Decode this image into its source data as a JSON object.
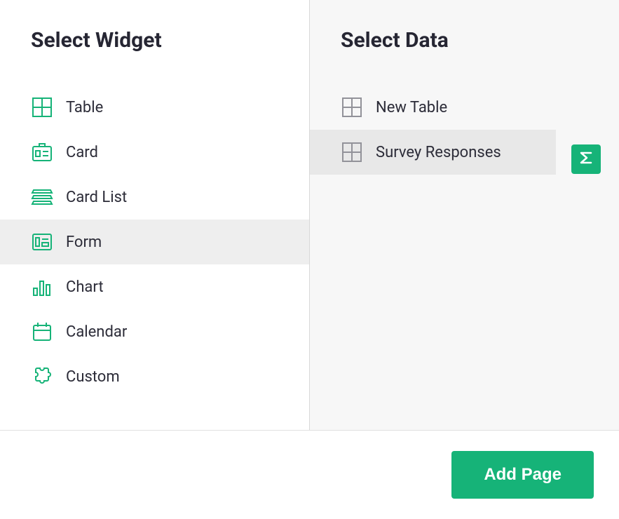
{
  "left": {
    "title": "Select Widget",
    "items": [
      {
        "id": "table",
        "label": "Table",
        "icon": "table-icon",
        "selected": false
      },
      {
        "id": "card",
        "label": "Card",
        "icon": "card-icon",
        "selected": false
      },
      {
        "id": "cardlist",
        "label": "Card List",
        "icon": "cardlist-icon",
        "selected": false
      },
      {
        "id": "form",
        "label": "Form",
        "icon": "form-icon",
        "selected": true
      },
      {
        "id": "chart",
        "label": "Chart",
        "icon": "chart-icon",
        "selected": false
      },
      {
        "id": "calendar",
        "label": "Calendar",
        "icon": "calendar-icon",
        "selected": false
      },
      {
        "id": "custom",
        "label": "Custom",
        "icon": "custom-icon",
        "selected": false
      }
    ]
  },
  "right": {
    "title": "Select Data",
    "items": [
      {
        "id": "new-table",
        "label": "New Table",
        "icon": "table-icon",
        "selected": false,
        "summary": false
      },
      {
        "id": "survey-responses",
        "label": "Survey Responses",
        "icon": "table-icon",
        "selected": true,
        "summary": true
      }
    ]
  },
  "footer": {
    "add_page_label": "Add Page"
  },
  "colors": {
    "accent": "#16b378"
  }
}
